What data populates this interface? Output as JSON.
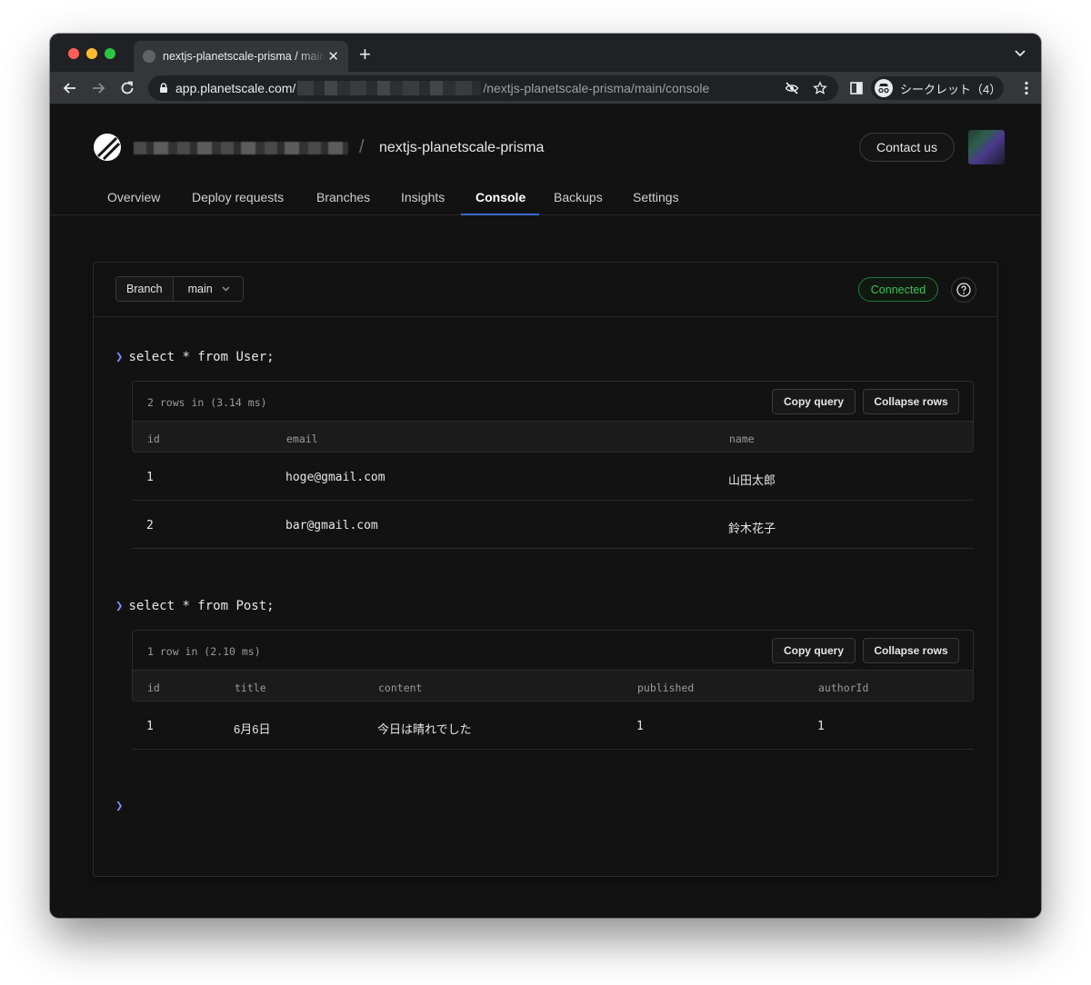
{
  "browser": {
    "tab_title": "nextjs-planetscale-prisma / main",
    "new_tab": "+",
    "url_host": "app.planetscale.com/",
    "url_path": "/nextjs-planetscale-prisma/main/console",
    "profile_label": "シークレット（4）"
  },
  "header": {
    "db_name": "nextjs-planetscale-prisma",
    "contact_label": "Contact us"
  },
  "nav": {
    "tabs": [
      "Overview",
      "Deploy requests",
      "Branches",
      "Insights",
      "Console",
      "Backups",
      "Settings"
    ],
    "active": "Console"
  },
  "console": {
    "branch_label": "Branch",
    "branch_value": "main",
    "status": "Connected",
    "copy_label": "Copy query",
    "collapse_label": "Collapse rows",
    "queries": [
      {
        "query": "select * from User;",
        "meta": "2 rows in (3.14 ms)",
        "columns": [
          "id",
          "email",
          "name"
        ],
        "rows": [
          [
            "1",
            "hoge@gmail.com",
            "山田太郎"
          ],
          [
            "2",
            "bar@gmail.com",
            "鈴木花子"
          ]
        ]
      },
      {
        "query": "select * from Post;",
        "meta": "1 row in (2.10 ms)",
        "columns": [
          "id",
          "title",
          "content",
          "published",
          "authorId"
        ],
        "rows": [
          [
            "1",
            "6月6日",
            "今日は晴れでした",
            "1",
            "1"
          ]
        ]
      }
    ]
  },
  "colors": {
    "accent": "#3b6ac7",
    "connected": "#3fbf5f",
    "prompt": "#7f8cff"
  }
}
